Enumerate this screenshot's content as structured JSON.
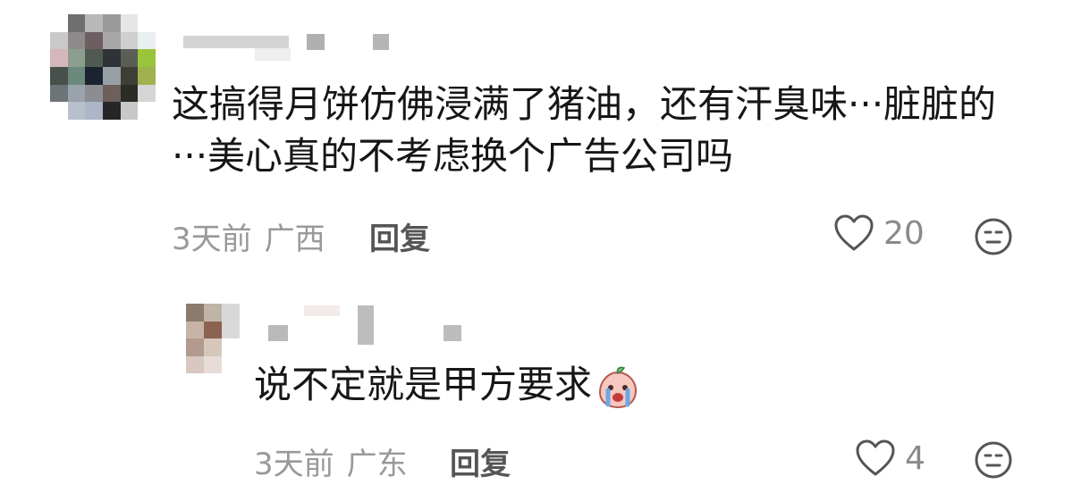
{
  "comments": [
    {
      "text": "这搞得月饼仿佛浸满了猪油，还有汗臭味···脏脏的···美心真的不考虑换个广告公司吗",
      "time": "3天前",
      "region": "广西",
      "reply_label": "回复",
      "like_count": "20"
    }
  ],
  "reply": {
    "text": "说不定就是甲方要求",
    "emoji": "crying-peach-sticker",
    "time": "3天前",
    "region": "广东",
    "reply_label": "回复",
    "like_count": "4"
  },
  "icons": {
    "like": "heart-outline-icon",
    "reaction": "meh-face-icon"
  },
  "colors": {
    "text": "#161616",
    "meta": "#999999",
    "icon": "#555555"
  }
}
